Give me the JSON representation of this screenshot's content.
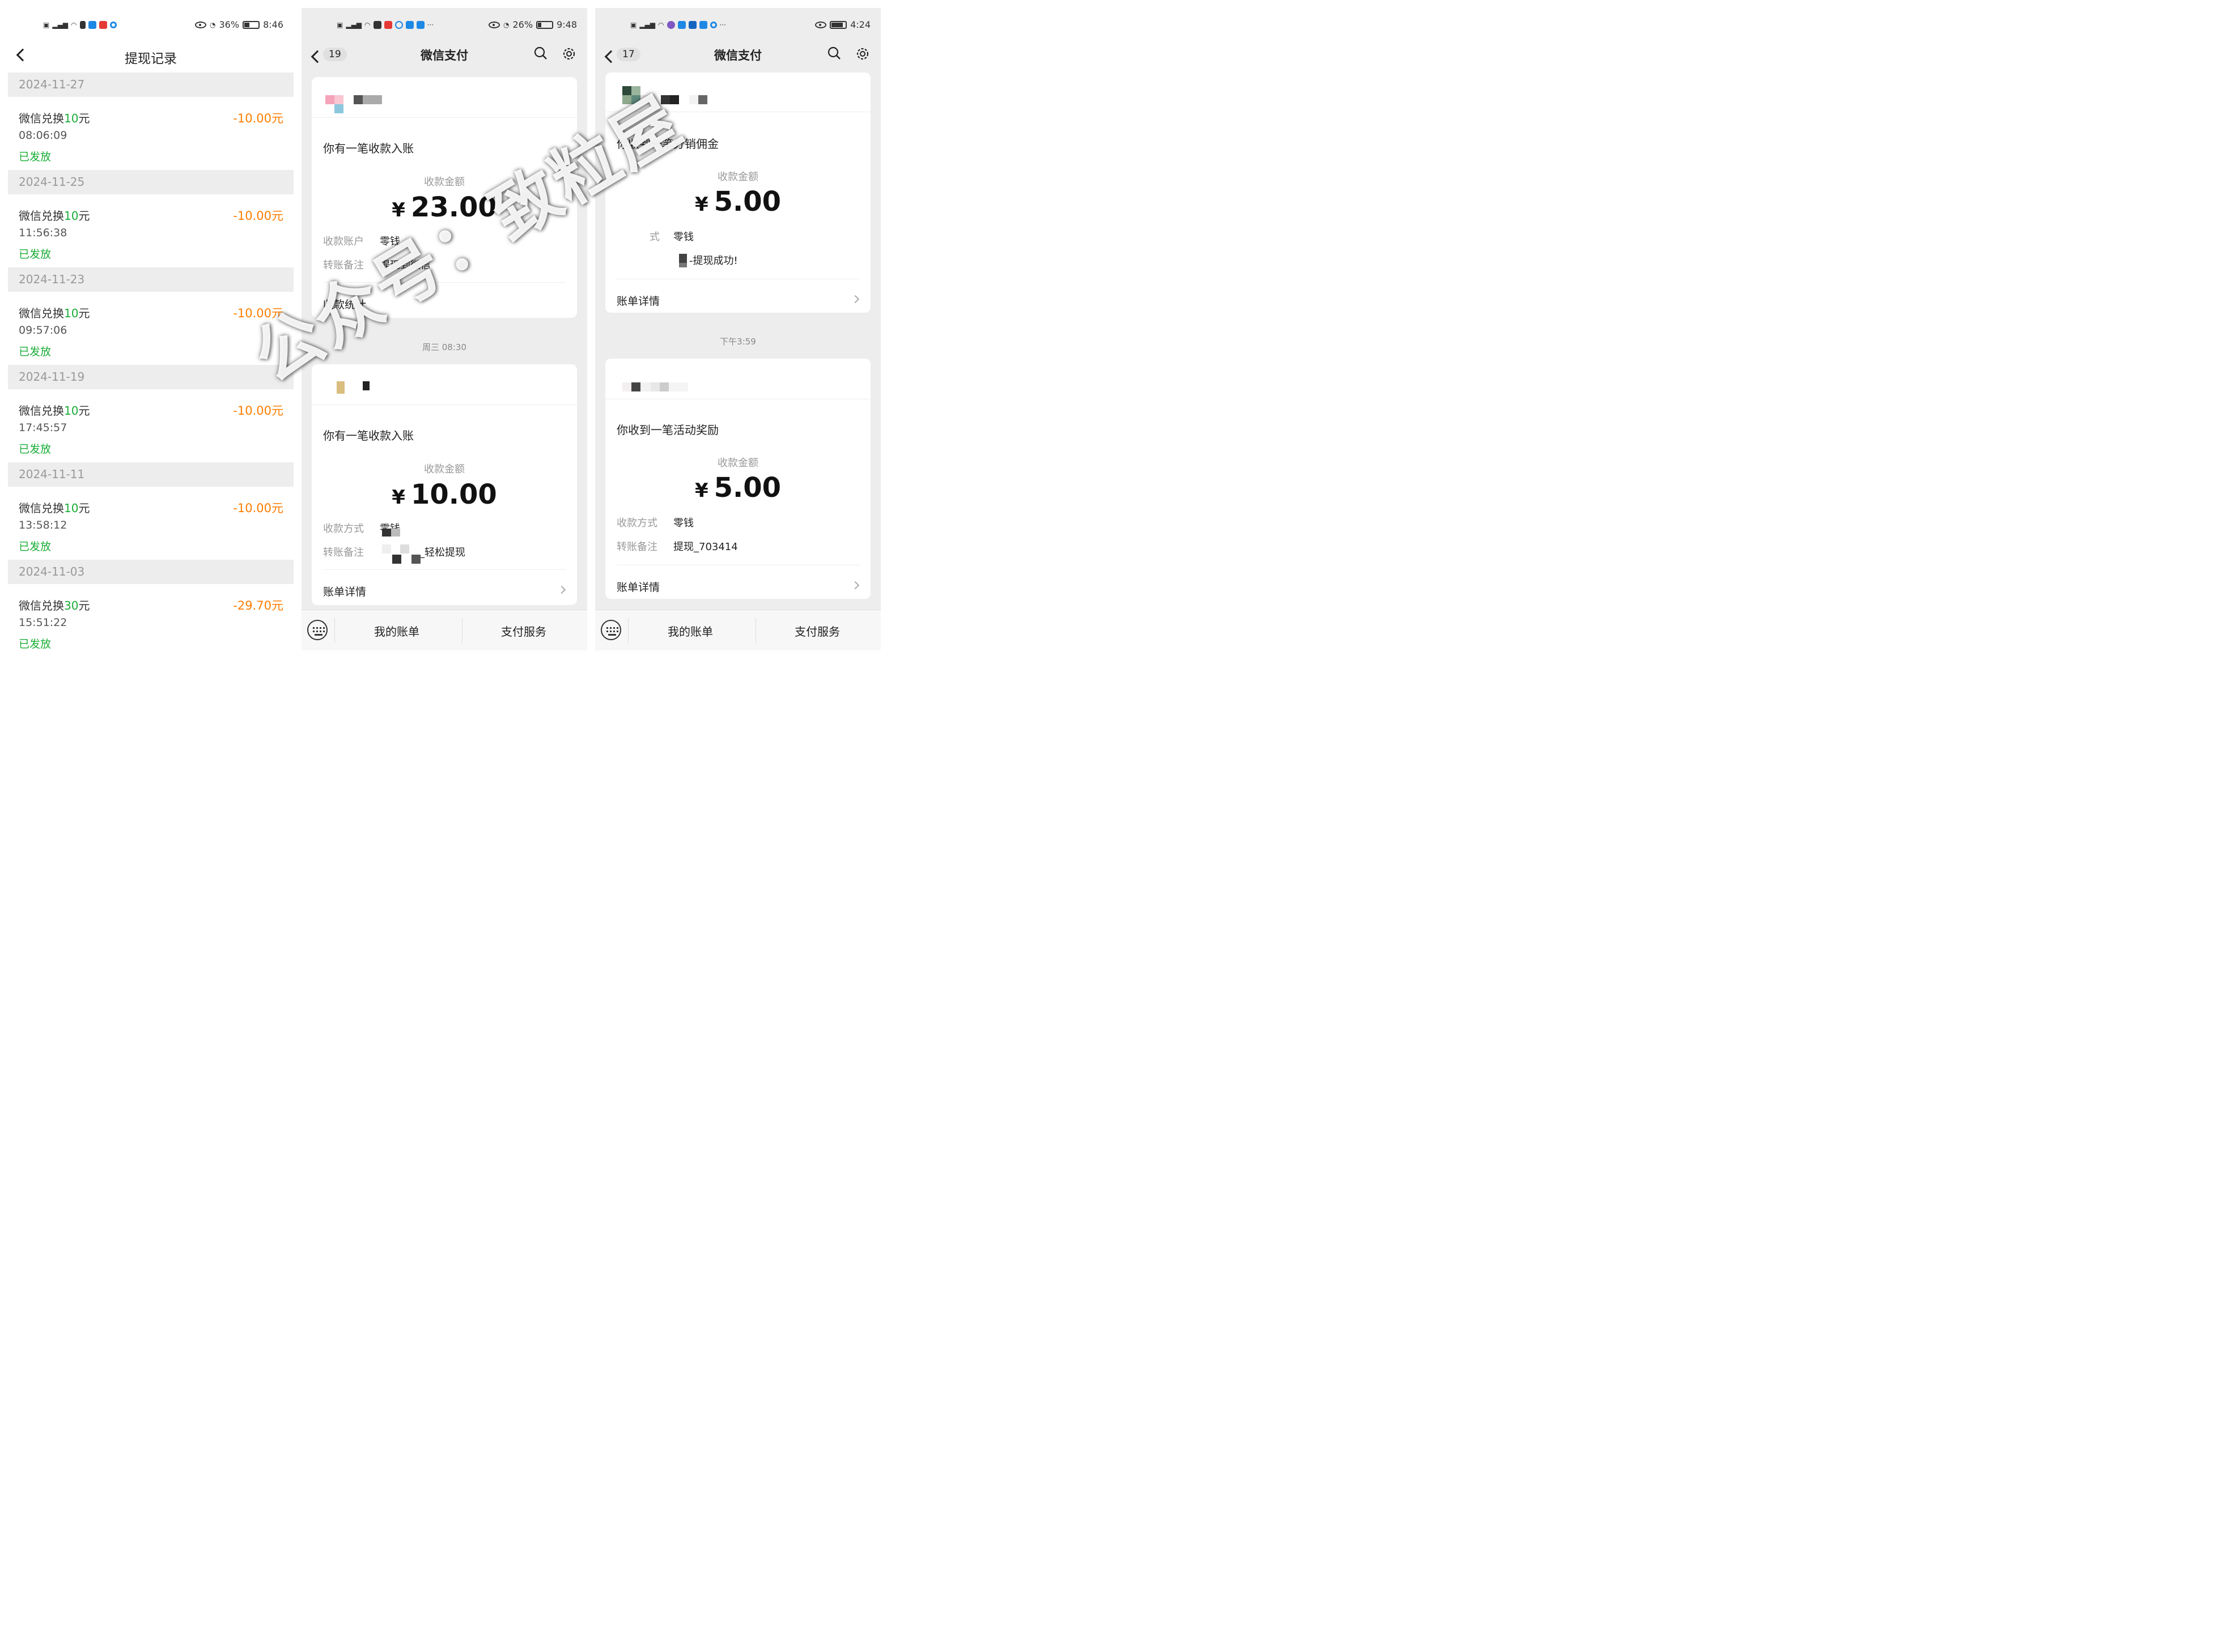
{
  "phone1": {
    "status": {
      "battery": "36%",
      "time": "8:46"
    },
    "title": "提现记录",
    "records": [
      {
        "date": "2024-11-27",
        "name_prefix": "微信兑换",
        "name_num": "10",
        "name_suffix": "元",
        "amount": "-10.00元",
        "time": "08:06:09",
        "status": "已发放"
      },
      {
        "date": "2024-11-25",
        "name_prefix": "微信兑换",
        "name_num": "10",
        "name_suffix": "元",
        "amount": "-10.00元",
        "time": "11:56:38",
        "status": "已发放"
      },
      {
        "date": "2024-11-23",
        "name_prefix": "微信兑换",
        "name_num": "10",
        "name_suffix": "元",
        "amount": "-10.00元",
        "time": "09:57:06",
        "status": "已发放"
      },
      {
        "date": "2024-11-19",
        "name_prefix": "微信兑换",
        "name_num": "10",
        "name_suffix": "元",
        "amount": "-10.00元",
        "time": "17:45:57",
        "status": "已发放"
      },
      {
        "date": "2024-11-11",
        "name_prefix": "微信兑换",
        "name_num": "10",
        "name_suffix": "元",
        "amount": "-10.00元",
        "time": "13:58:12",
        "status": "已发放"
      },
      {
        "date": "2024-11-03",
        "name_prefix": "微信兑换",
        "name_num": "30",
        "name_suffix": "元",
        "amount": "-29.70元",
        "time": "15:51:22",
        "status": "已发放"
      }
    ]
  },
  "phone2": {
    "status": {
      "battery": "26%",
      "time": "9:48"
    },
    "badge": "19",
    "title": "微信支付",
    "card1": {
      "heading": "你有一笔收款入账",
      "amount_label": "收款金额",
      "currency": "¥",
      "amount": "23.00",
      "row1_key": "收款账户",
      "row1_val": "零钱",
      "row2_key": "转账备注",
      "row2_val": "提现到微信",
      "footer": "收款统计"
    },
    "timestamp": "周三 08:30",
    "card2": {
      "heading": "你有一笔收款入账",
      "amount_label": "收款金额",
      "currency": "¥",
      "amount": "10.00",
      "row1_key": "收款方式",
      "row1_val": "零钱",
      "row2_key": "转账备注",
      "row2_val": "_轻松提现",
      "footer": "账单详情"
    },
    "tabs": [
      "我的账单",
      "支付服务"
    ]
  },
  "phone3": {
    "status": {
      "time": "4:24"
    },
    "badge": "17",
    "title": "微信支付",
    "card1": {
      "heading": "你收到一笔分销佣金",
      "amount_label": "收款金额",
      "currency": "¥",
      "amount": "5.00",
      "row1_key": "式",
      "row1_val": "零钱",
      "row2_val": "-提现成功!",
      "footer": "账单详情"
    },
    "timestamp": "下午3:59",
    "card2": {
      "heading": "你收到一笔活动奖励",
      "amount_label": "收款金额",
      "currency": "¥",
      "amount": "5.00",
      "row1_key": "收款方式",
      "row1_val": "零钱",
      "row2_key": "转账备注",
      "row2_val": "提现_703414",
      "footer": "账单详情"
    },
    "tabs": [
      "我的账单",
      "支付服务"
    ]
  },
  "watermark": "公众号：致粒屋",
  "colors": {
    "green": "#19ad36",
    "orange": "#ff7d00",
    "gray_bg": "#ededed"
  }
}
